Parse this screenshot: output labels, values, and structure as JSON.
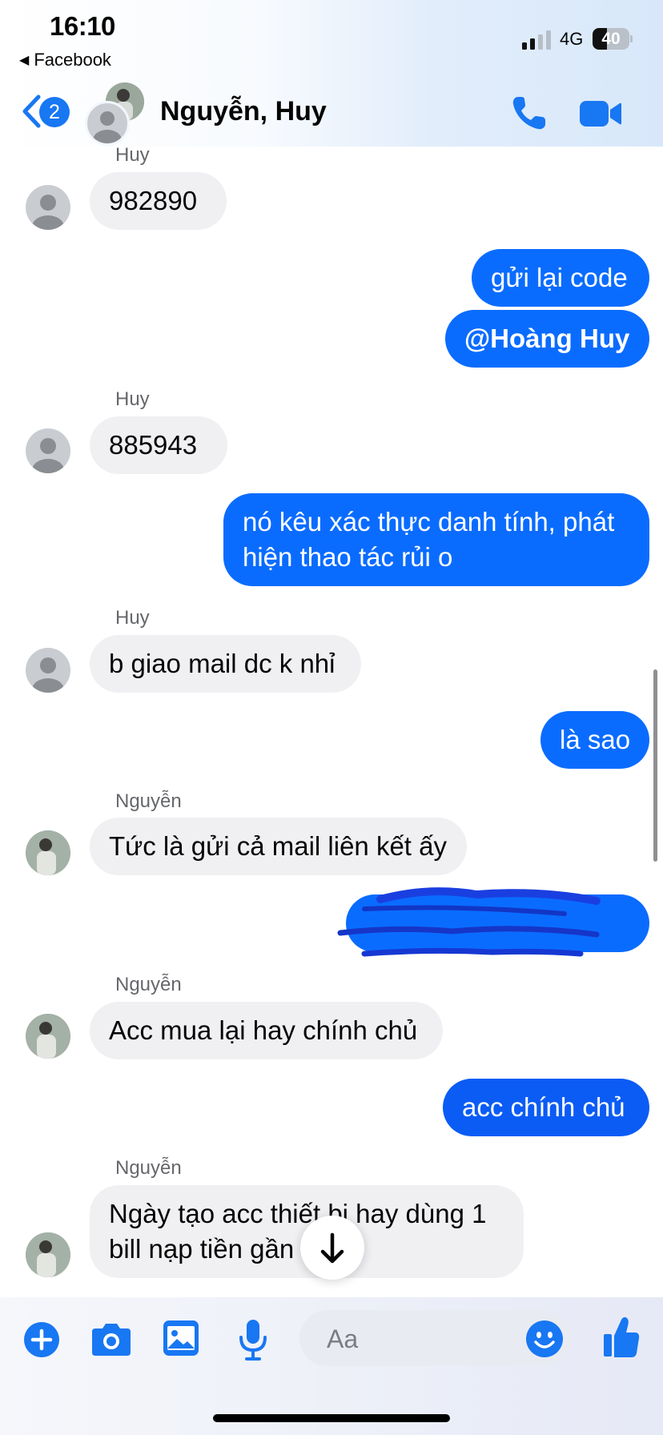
{
  "status_bar": {
    "time": "16:10",
    "back_app": "Facebook",
    "network": "4G",
    "battery": "40",
    "battery_level": 0.4
  },
  "header": {
    "badge_count": "2",
    "title": "Nguyễn, Huy"
  },
  "messages": [
    {
      "sender": "Huy",
      "text": "982890"
    },
    {
      "text": "gửi lại code"
    },
    {
      "text": "@Hoàng Huy"
    },
    {
      "sender": "Huy",
      "text": "885943"
    },
    {
      "text_lines": [
        "nó kêu xác thực danh tính, phát",
        "hiện thao tác rủi o"
      ]
    },
    {
      "sender": "Huy",
      "text": "b giao mail dc k nhỉ"
    },
    {
      "text": "là sao"
    },
    {
      "sender": "Nguyễn",
      "text": "Tức là gửi cả mail liên kết ấy"
    },
    {
      "text": ""
    },
    {
      "sender": "Nguyễn",
      "text": "Acc mua lại hay chính chủ"
    },
    {
      "text": "acc chính chủ"
    },
    {
      "sender": "Nguyễn",
      "text_lines": [
        "Ngày tạo acc thiết bị hay dùng 1",
        "bill nạp tiền gần"
      ]
    }
  ],
  "composer": {
    "placeholder": "Aa"
  },
  "colors": {
    "accent": "#0a6cff",
    "incoming_bubble": "#f0f0f3",
    "icon_blue": "#1877f2"
  }
}
